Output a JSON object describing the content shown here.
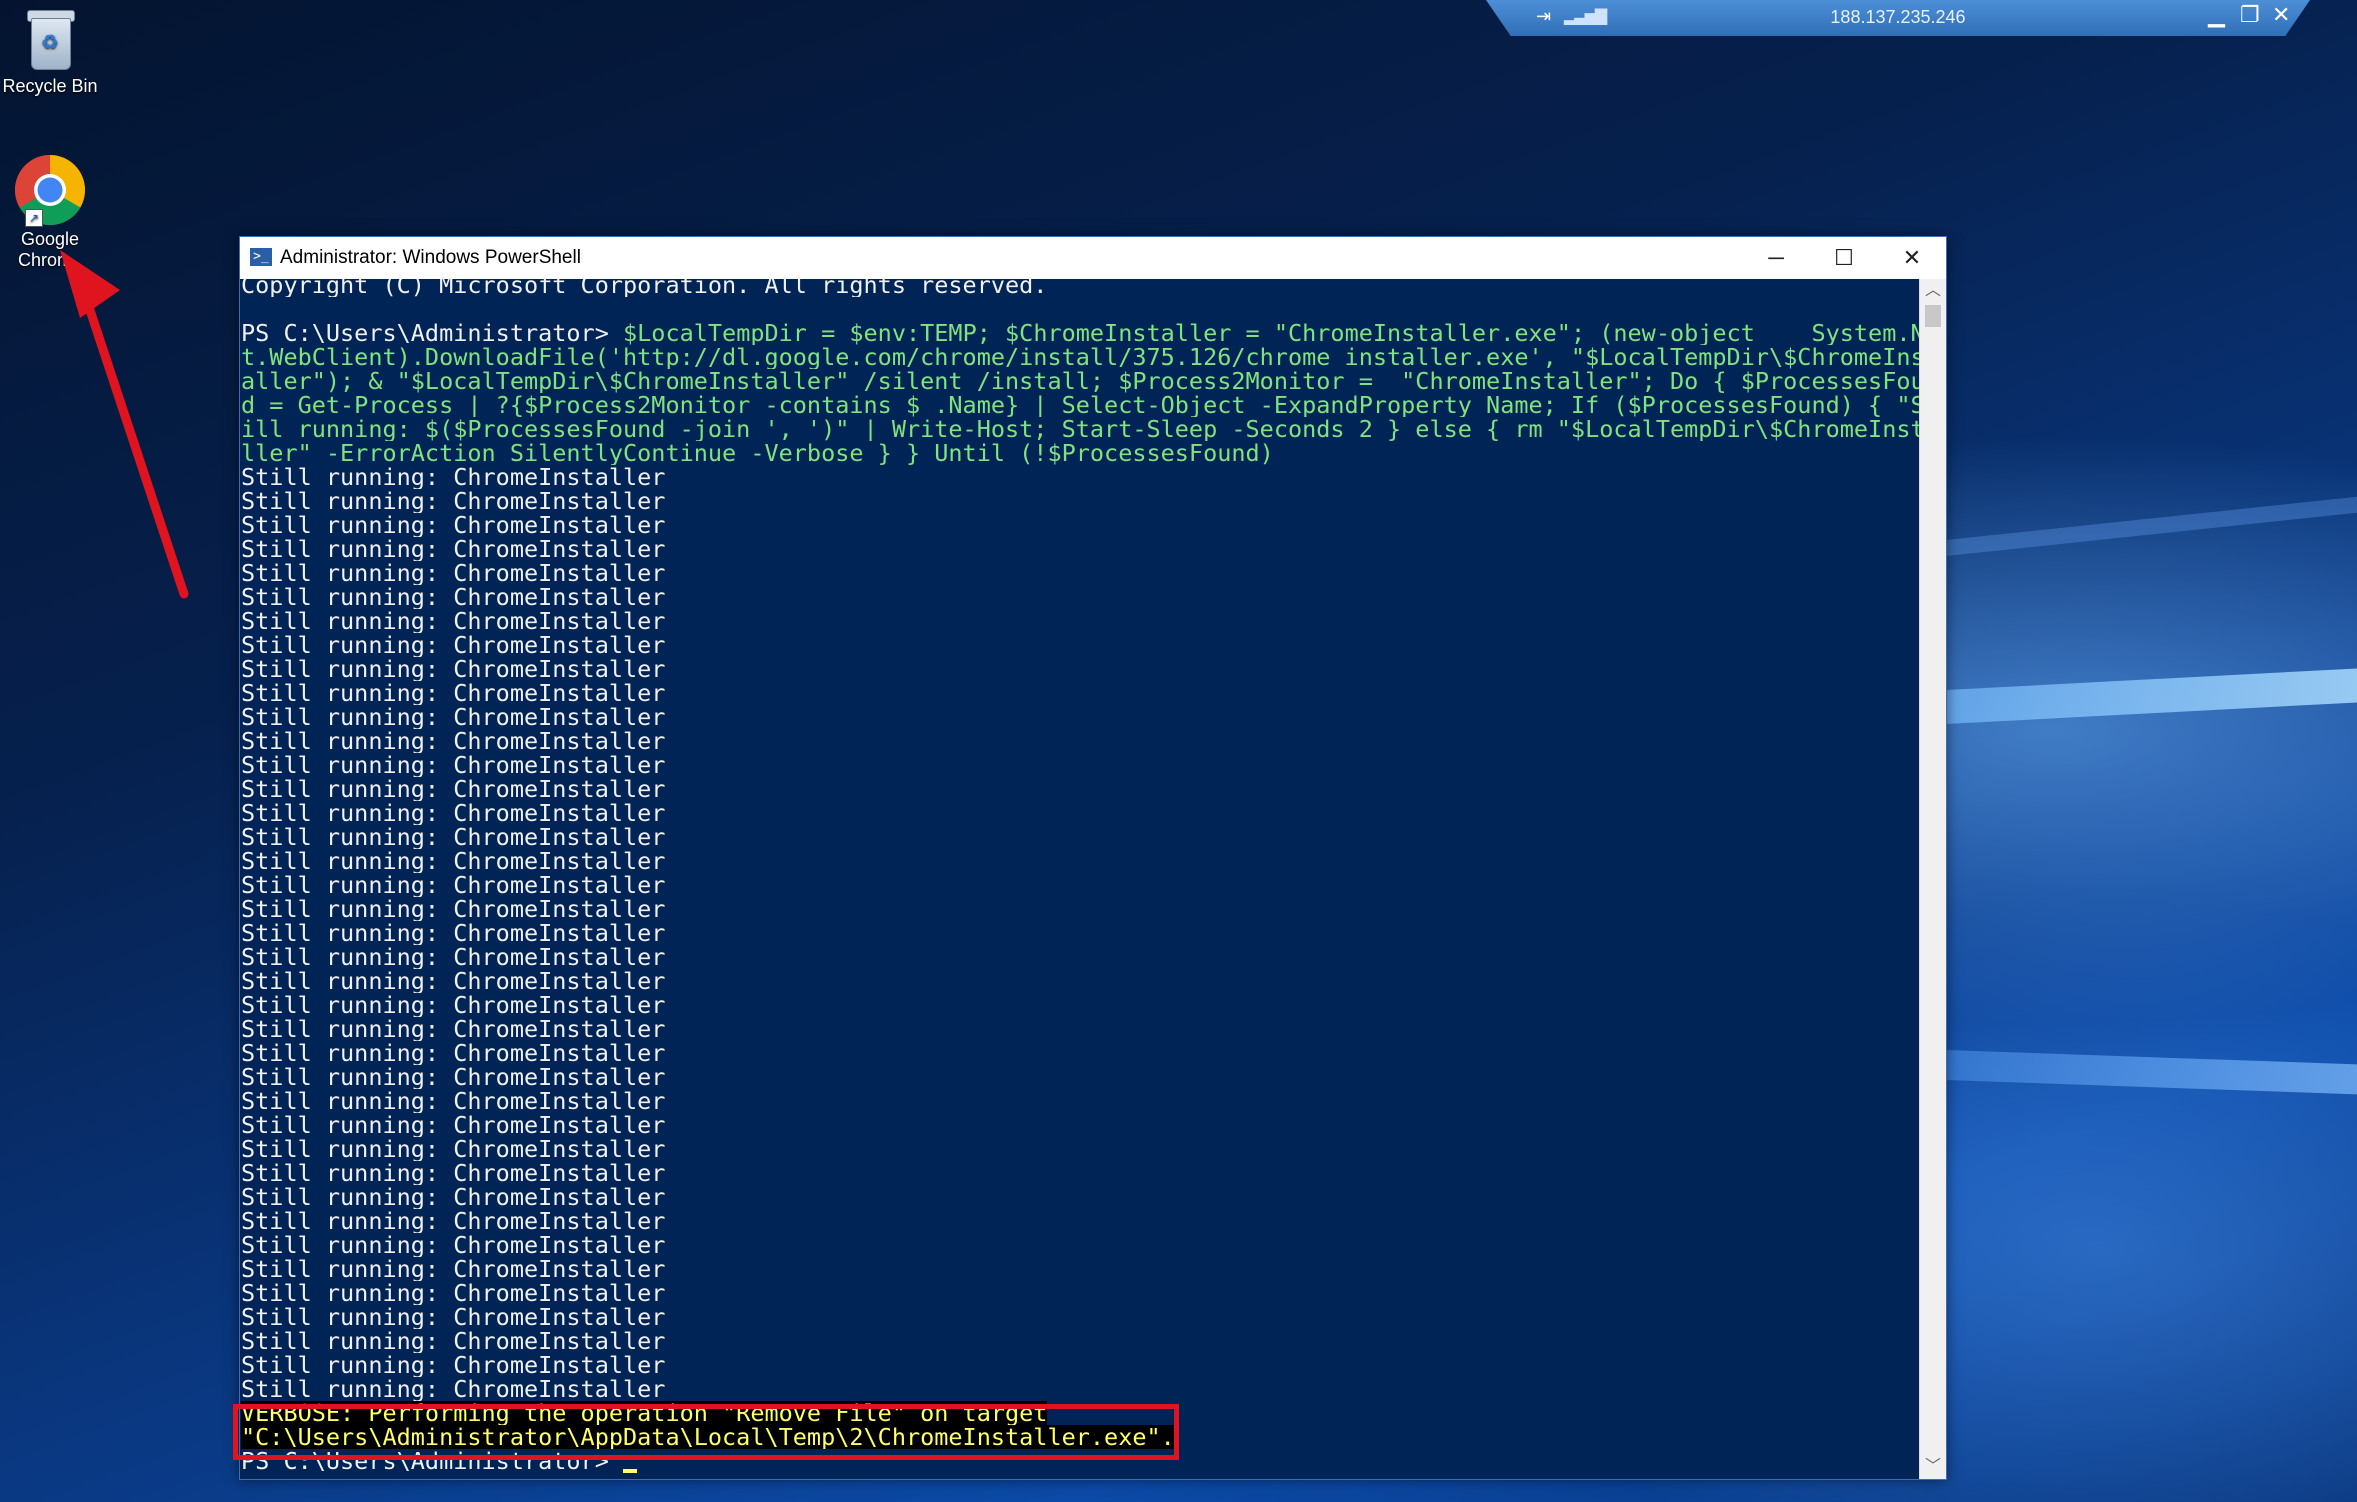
{
  "desktop": {
    "icons": [
      {
        "label": "Recycle Bin",
        "icon": "recycle-bin-icon"
      },
      {
        "label_line1": "Google",
        "label_line2": "Chrome",
        "icon": "chrome-icon"
      }
    ],
    "accent_color": "#0b4aa8"
  },
  "rdp_bar": {
    "host": "188.137.235.246",
    "icons": [
      "pin-icon",
      "signal-icon",
      "minimize-icon",
      "restore-icon",
      "close-icon"
    ]
  },
  "window": {
    "title": "Administrator: Windows PowerShell",
    "icon": "powershell-icon",
    "buttons": [
      "minimize",
      "maximize",
      "close"
    ]
  },
  "console": {
    "copyright": "Copyright (C) Microsoft Corporation. All rights reserved.",
    "prompt": "PS C:\\Users\\Administrator> ",
    "command_lines": [
      "$LocalTempDir = $env:TEMP; $ChromeInstaller = \"ChromeInstaller.exe\"; (new-object    System.Ne",
      "t.WebClient).DownloadFile('http://dl.google.com/chrome/install/375.126/chrome_installer.exe', \"$LocalTempDir\\$ChromeInst",
      "aller\"); & \"$LocalTempDir\\$ChromeInstaller\" /silent /install; $Process2Monitor =  \"ChromeInstaller\"; Do { $ProcessesFoun",
      "d = Get-Process | ?{$Process2Monitor -contains $_.Name} | Select-Object -ExpandProperty Name; If ($ProcessesFound) { \"St",
      "ill running: $($ProcessesFound -join ', ')\" | Write-Host; Start-Sleep -Seconds 2 } else { rm \"$LocalTempDir\\$ChromeInsta",
      "ller\" -ErrorAction SilentlyContinue -Verbose } } Until (!$ProcessesFound)"
    ],
    "status_line": "Still running: ChromeInstaller",
    "status_repeat": 39,
    "verbose_line1": "VERBOSE: Performing the operation \"Remove File\" on target",
    "verbose_line2": "\"C:\\Users\\Administrator\\AppData\\Local\\Temp\\2\\ChromeInstaller.exe\".",
    "final_prompt": "PS C:\\Users\\Administrator> "
  },
  "annotation": {
    "highlight_color": "#e0141e",
    "arrow_color": "#e0141e"
  }
}
